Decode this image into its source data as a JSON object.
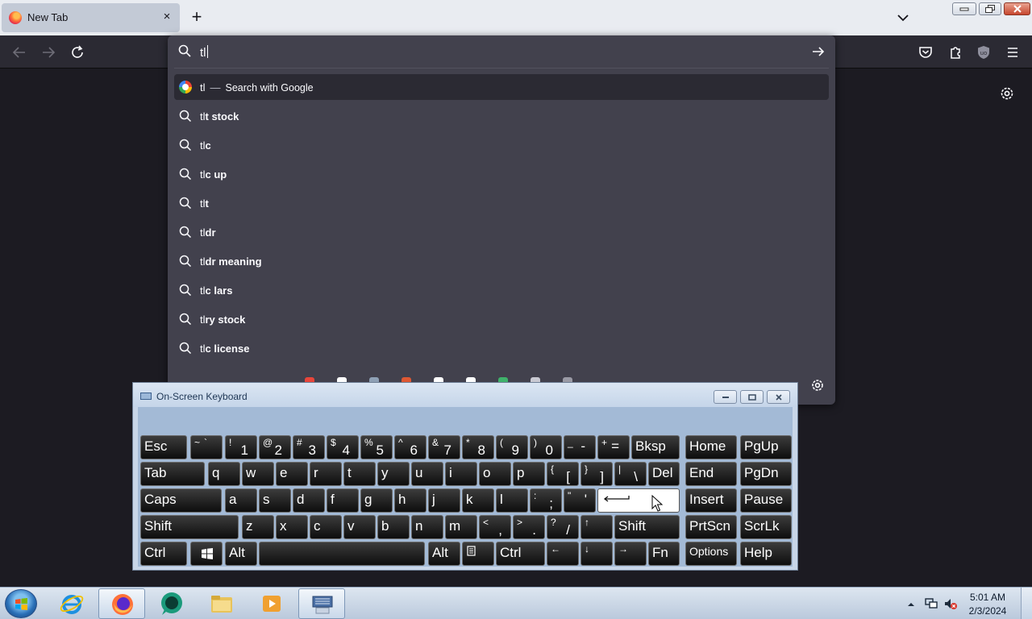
{
  "browser": {
    "tab_title": "New Tab",
    "tab_close": "×",
    "new_tab": "+"
  },
  "urlbar": {
    "query": "tl",
    "search_engine_row": {
      "typed": "tl",
      "separator": "—",
      "action": "Search with Google"
    },
    "suggestions": [
      {
        "typed": "tl",
        "completion": "t stock"
      },
      {
        "typed": "tl",
        "completion": "c"
      },
      {
        "typed": "tl",
        "completion": "c up"
      },
      {
        "typed": "tl",
        "completion": "t"
      },
      {
        "typed": "tl",
        "completion": "dr"
      },
      {
        "typed": "tl",
        "completion": "dr meaning"
      },
      {
        "typed": "tl",
        "completion": "c lars"
      },
      {
        "typed": "tl",
        "completion": "ry stock"
      },
      {
        "typed": "tl",
        "completion": "c license"
      }
    ]
  },
  "osk": {
    "title": "On-Screen Keyboard",
    "keys": {
      "esc": "Esc",
      "bksp": "Bksp",
      "home": "Home",
      "pgup": "PgUp",
      "tab": "Tab",
      "del": "Del",
      "end": "End",
      "pgdn": "PgDn",
      "caps": "Caps",
      "insert": "Insert",
      "pause": "Pause",
      "shift_l": "Shift",
      "shift_r": "Shift",
      "prtscn": "PrtScn",
      "scrlk": "ScrLk",
      "ctrl_l": "Ctrl",
      "alt_l": "Alt",
      "alt_r": "Alt",
      "ctrl_r": "Ctrl",
      "fn": "Fn",
      "options": "Options",
      "help": "Help",
      "num_row": [
        [
          "~",
          "`"
        ],
        [
          "!",
          "1"
        ],
        [
          "@",
          "2"
        ],
        [
          "#",
          "3"
        ],
        [
          "$",
          "4"
        ],
        [
          "%",
          "5"
        ],
        [
          "^",
          "6"
        ],
        [
          "&",
          "7"
        ],
        [
          "*",
          "8"
        ],
        [
          "(",
          "9"
        ],
        [
          ")",
          "0"
        ],
        [
          "_",
          "-"
        ],
        [
          "+",
          "="
        ]
      ],
      "row_q": [
        "q",
        "w",
        "e",
        "r",
        "t",
        "y",
        "u",
        "i",
        "o",
        "p"
      ],
      "row_q_sym": [
        [
          "{",
          "["
        ],
        [
          "}",
          "]"
        ],
        [
          "|",
          "\\"
        ]
      ],
      "row_a": [
        "a",
        "s",
        "d",
        "f",
        "g",
        "h",
        "j",
        "k",
        "l"
      ],
      "row_a_sym": [
        [
          ":",
          ";"
        ],
        [
          "\"",
          "'"
        ]
      ],
      "row_z": [
        "z",
        "x",
        "c",
        "v",
        "b",
        "n",
        "m"
      ],
      "row_z_sym": [
        [
          "<",
          ","
        ],
        [
          ">",
          "."
        ],
        [
          "?",
          "/"
        ]
      ],
      "arrows": {
        "up": "↑",
        "left": "←",
        "down": "↓",
        "right": "→"
      }
    }
  },
  "taskbar": {
    "time": "5:01 AM",
    "date": "2/3/2024"
  }
}
